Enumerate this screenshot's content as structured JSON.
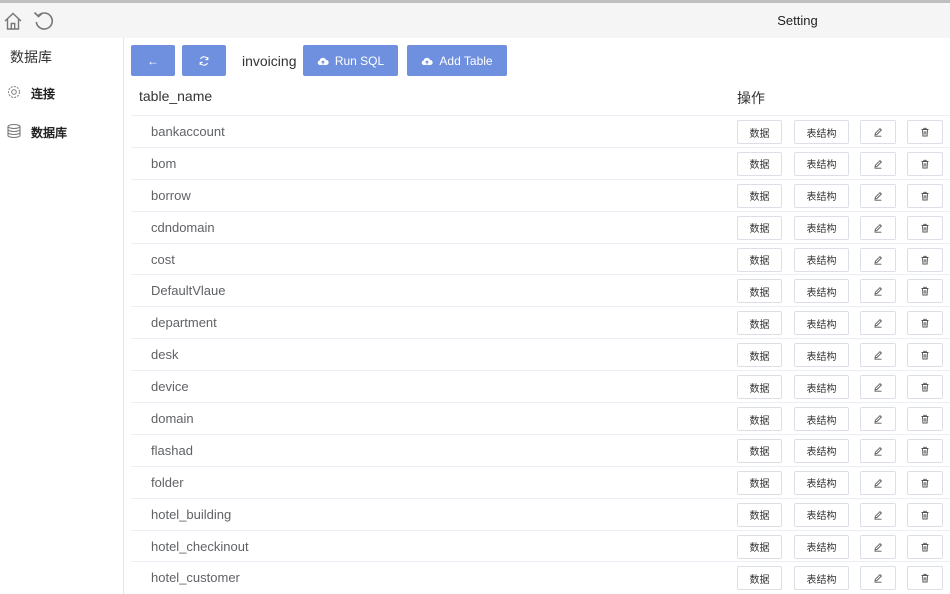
{
  "window": {
    "title": "Setting"
  },
  "sidebar": {
    "header": "数据库",
    "items": [
      {
        "label": "连接",
        "icon": "gear-icon"
      },
      {
        "label": "数据库",
        "icon": "database-icon"
      }
    ]
  },
  "toolbar": {
    "back_icon": "←",
    "refresh_icon": "⟳",
    "db_name": "invoicing",
    "run_sql_label": "Run SQL",
    "add_table_label": "Add Table"
  },
  "table": {
    "col_name": "table_name",
    "col_ops": "操作",
    "data_label": "数据",
    "structure_label": "表结构",
    "rows": [
      "bankaccount",
      "bom",
      "borrow",
      "cdndomain",
      "cost",
      "DefaultVlaue",
      "department",
      "desk",
      "device",
      "domain",
      "flashad",
      "folder",
      "hotel_building",
      "hotel_checkinout",
      "hotel_customer"
    ]
  },
  "colors": {
    "primary": "#6f8fdf",
    "border": "#dcdfe6"
  }
}
